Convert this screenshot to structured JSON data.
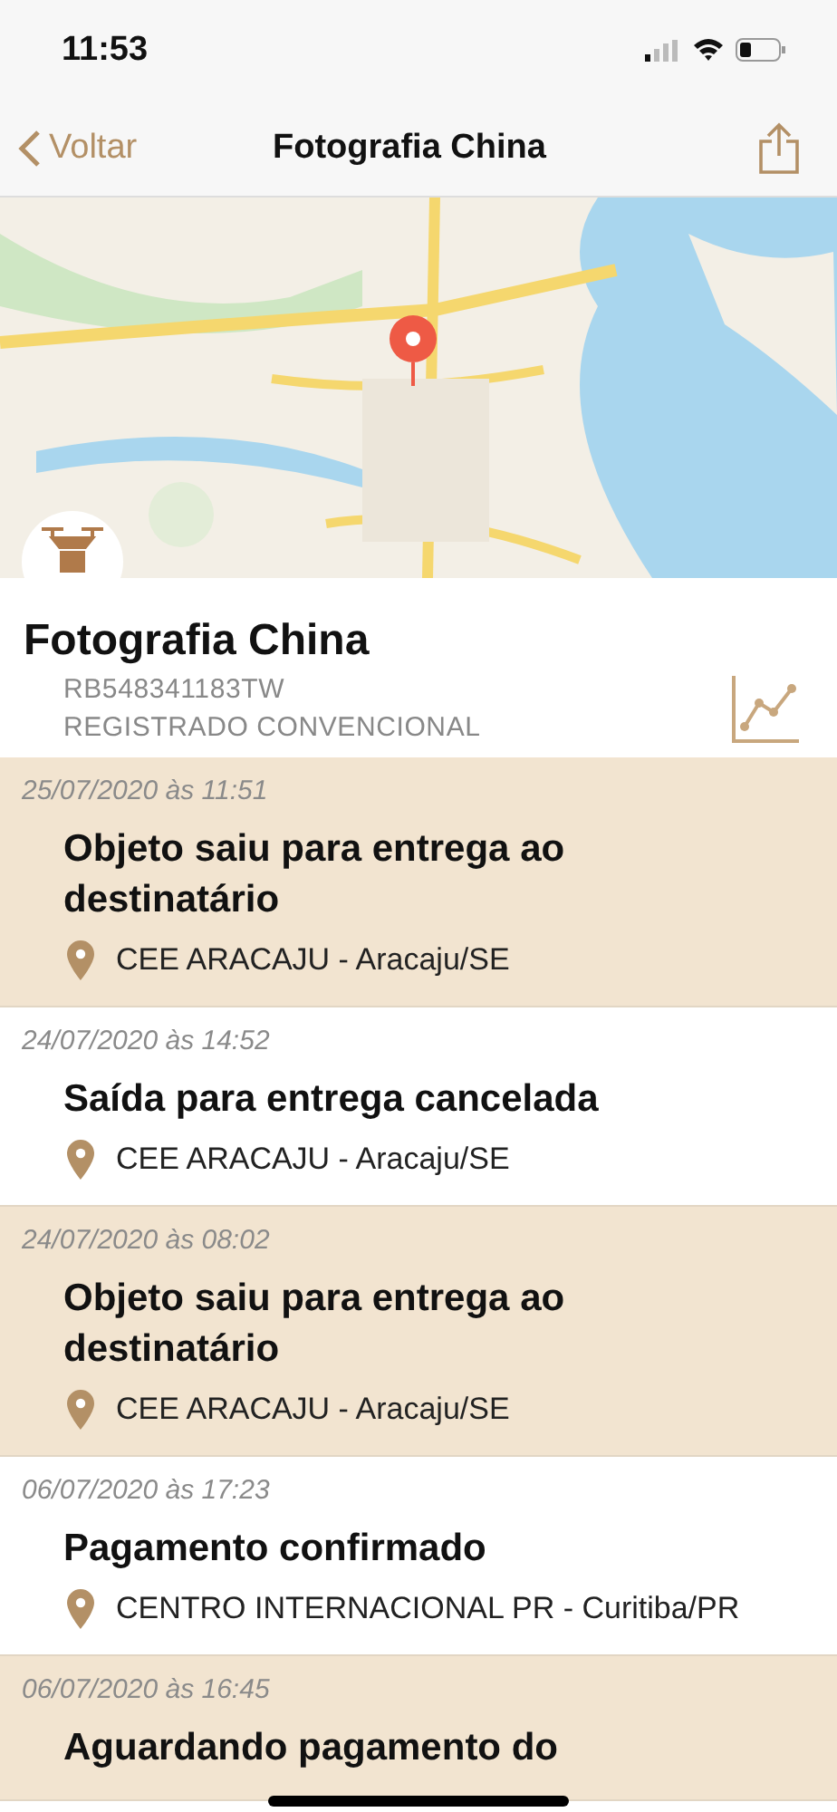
{
  "status_bar": {
    "time": "11:53"
  },
  "nav": {
    "back": "Voltar",
    "title": "Fotografia China"
  },
  "package": {
    "name": "Fotografia China",
    "code": "RB548341183TW",
    "service": "REGISTRADO CONVENCIONAL"
  },
  "events": [
    {
      "datetime": "25/07/2020 às 11:51",
      "title": "Objeto saiu para entrega ao destinatário",
      "location": "CEE ARACAJU - Aracaju/SE"
    },
    {
      "datetime": "24/07/2020 às 14:52",
      "title": "Saída para entrega cancelada",
      "location": "CEE ARACAJU - Aracaju/SE"
    },
    {
      "datetime": "24/07/2020 às 08:02",
      "title": "Objeto saiu para entrega ao destinatário",
      "location": "CEE ARACAJU - Aracaju/SE"
    },
    {
      "datetime": "06/07/2020 às 17:23",
      "title": "Pagamento confirmado",
      "location": "CENTRO INTERNACIONAL PR - Curitiba/PR"
    },
    {
      "datetime": "06/07/2020 às 16:45",
      "title": "Aguardando pagamento do"
    }
  ]
}
